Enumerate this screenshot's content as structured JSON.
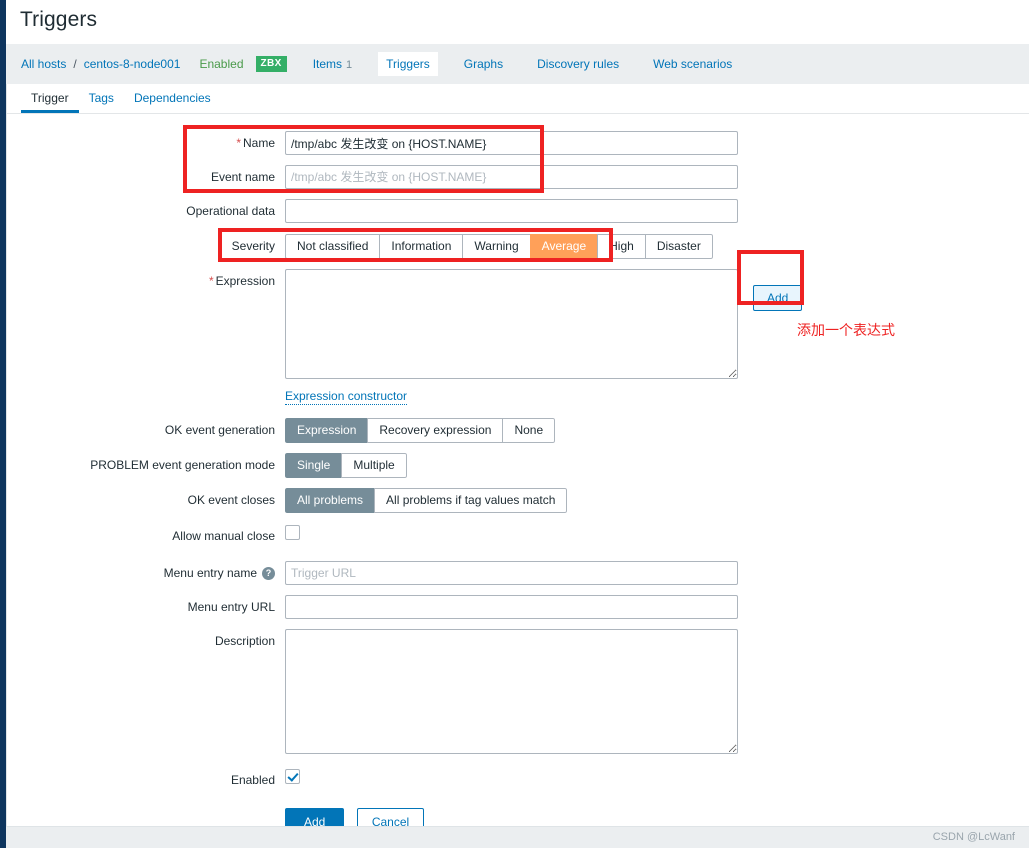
{
  "page": {
    "title": "Triggers"
  },
  "breadcrumb": {
    "all_hosts": "All hosts",
    "separator": "/",
    "host": "centos-8-node001",
    "status": "Enabled",
    "agent_badge": "ZBX",
    "tabs": [
      {
        "label": "Items",
        "count": "1",
        "active": false
      },
      {
        "label": "Triggers",
        "count": "",
        "active": true
      },
      {
        "label": "Graphs",
        "count": "",
        "active": false
      },
      {
        "label": "Discovery rules",
        "count": "",
        "active": false
      },
      {
        "label": "Web scenarios",
        "count": "",
        "active": false
      }
    ]
  },
  "subtabs": [
    {
      "label": "Trigger",
      "active": true
    },
    {
      "label": "Tags",
      "active": false
    },
    {
      "label": "Dependencies",
      "active": false
    }
  ],
  "form": {
    "name": {
      "label": "Name",
      "required": "*",
      "value": "/tmp/abc 发生改变 on {HOST.NAME}",
      "placeholder": ""
    },
    "event_name": {
      "label": "Event name",
      "value": "",
      "placeholder": "/tmp/abc 发生改变 on {HOST.NAME}"
    },
    "operational_data": {
      "label": "Operational data",
      "value": "",
      "placeholder": ""
    },
    "severity": {
      "label": "Severity",
      "options": [
        {
          "label": "Not classified",
          "selected": false
        },
        {
          "label": "Information",
          "selected": false
        },
        {
          "label": "Warning",
          "selected": false
        },
        {
          "label": "Average",
          "selected": true
        },
        {
          "label": "High",
          "selected": false
        },
        {
          "label": "Disaster",
          "selected": false
        }
      ],
      "selected_value": "Average",
      "selected_color": "#ffa059"
    },
    "expression": {
      "label": "Expression",
      "required": "*",
      "value": "",
      "add_button": "Add",
      "constructor_link": "Expression constructor"
    },
    "ok_event_generation": {
      "label": "OK event generation",
      "options": [
        {
          "label": "Expression",
          "selected": true
        },
        {
          "label": "Recovery expression",
          "selected": false
        },
        {
          "label": "None",
          "selected": false
        }
      ],
      "selected_value": "Expression"
    },
    "problem_event_generation_mode": {
      "label": "PROBLEM event generation mode",
      "options": [
        {
          "label": "Single",
          "selected": true
        },
        {
          "label": "Multiple",
          "selected": false
        }
      ],
      "selected_value": "Single"
    },
    "ok_event_closes": {
      "label": "OK event closes",
      "options": [
        {
          "label": "All problems",
          "selected": true
        },
        {
          "label": "All problems if tag values match",
          "selected": false
        }
      ],
      "selected_value": "All problems"
    },
    "allow_manual_close": {
      "label": "Allow manual close",
      "checked": false
    },
    "menu_entry_name": {
      "label": "Menu entry name",
      "help": "?",
      "value": "",
      "placeholder": "Trigger URL"
    },
    "menu_entry_url": {
      "label": "Menu entry URL",
      "value": "",
      "placeholder": ""
    },
    "description": {
      "label": "Description",
      "value": "",
      "placeholder": ""
    },
    "enabled": {
      "label": "Enabled",
      "checked": true
    },
    "actions": {
      "submit": "Add",
      "cancel": "Cancel"
    }
  },
  "annotations": {
    "expression_note": "添加一个表达式",
    "highlight_color": "#ee2222"
  },
  "footer": {
    "watermark": "CSDN @LcWanf"
  }
}
